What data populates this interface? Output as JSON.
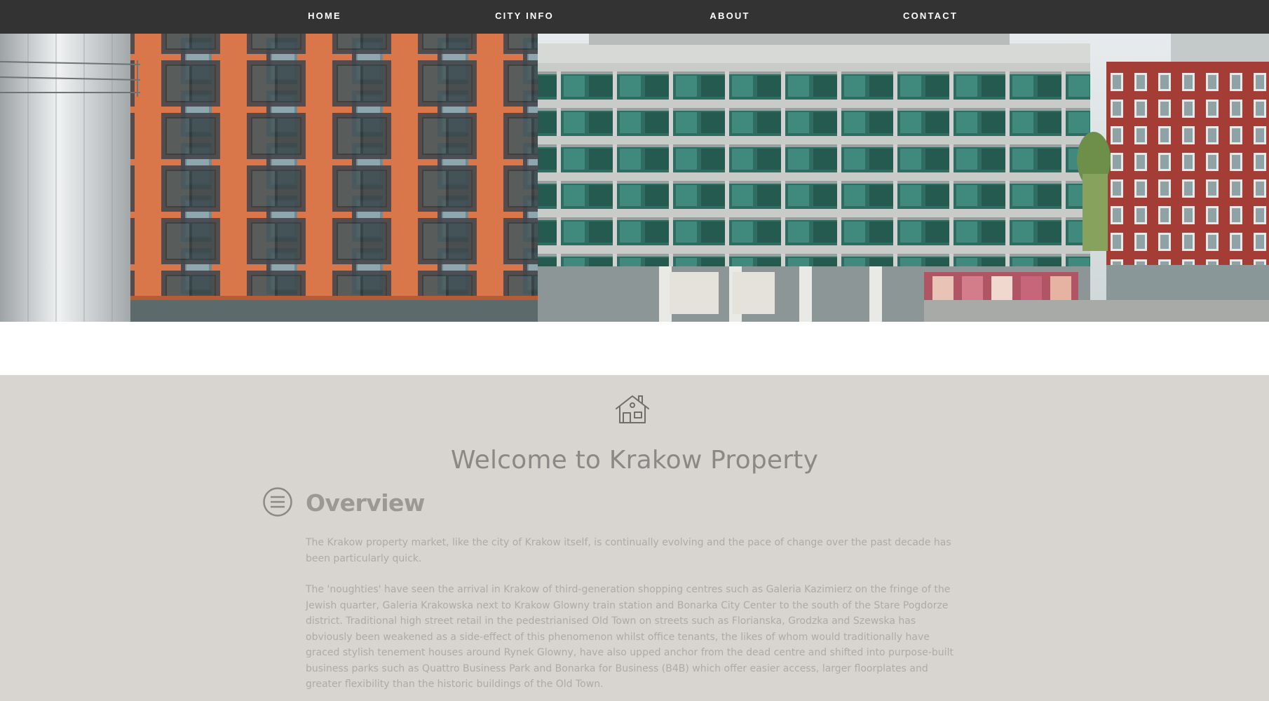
{
  "nav": {
    "items": [
      {
        "label": "HOME"
      },
      {
        "label": "CITY INFO"
      },
      {
        "label": "ABOUT"
      },
      {
        "label": "CONTACT"
      }
    ]
  },
  "hero": {
    "image": "modern office buildings photo"
  },
  "welcome": {
    "icon": "house-icon",
    "title": "Welcome to Krakow Property"
  },
  "overview": {
    "icon": "menu-circle-icon",
    "heading": "Overview",
    "paragraphs": [
      "The Krakow property market, like the city of Krakow itself, is continually evolving and the pace of change over the past decade has been particularly quick.",
      "The 'noughties' have seen the arrival in Krakow of third-generation shopping centres such as Galeria Kazimierz on the fringe of the Jewish quarter, Galeria Krakowska next to Krakow Glowny train station and Bonarka City Center to the south of the Stare Pogdorze district. Traditional high street retail in the pedestrianised Old Town on streets such as Florianska, Grodzka and Szewska has obviously been weakened as a side-effect of this phenomenon whilst office tenants, the likes of whom would traditionally have graced stylish tenement houses around Rynek Glowny, have also upped anchor from the dead centre and shifted into purpose-built business parks such as Quattro Business Park and Bonarka for Business (B4B) which offer easier access, larger floorplates and greater flexibility than the historic buildings of the Old Town."
    ]
  },
  "colors": {
    "nav_bg": "#333333",
    "content_bg": "#d8d5d0",
    "heading": "#8a8987",
    "body_text": "#adaba8"
  }
}
